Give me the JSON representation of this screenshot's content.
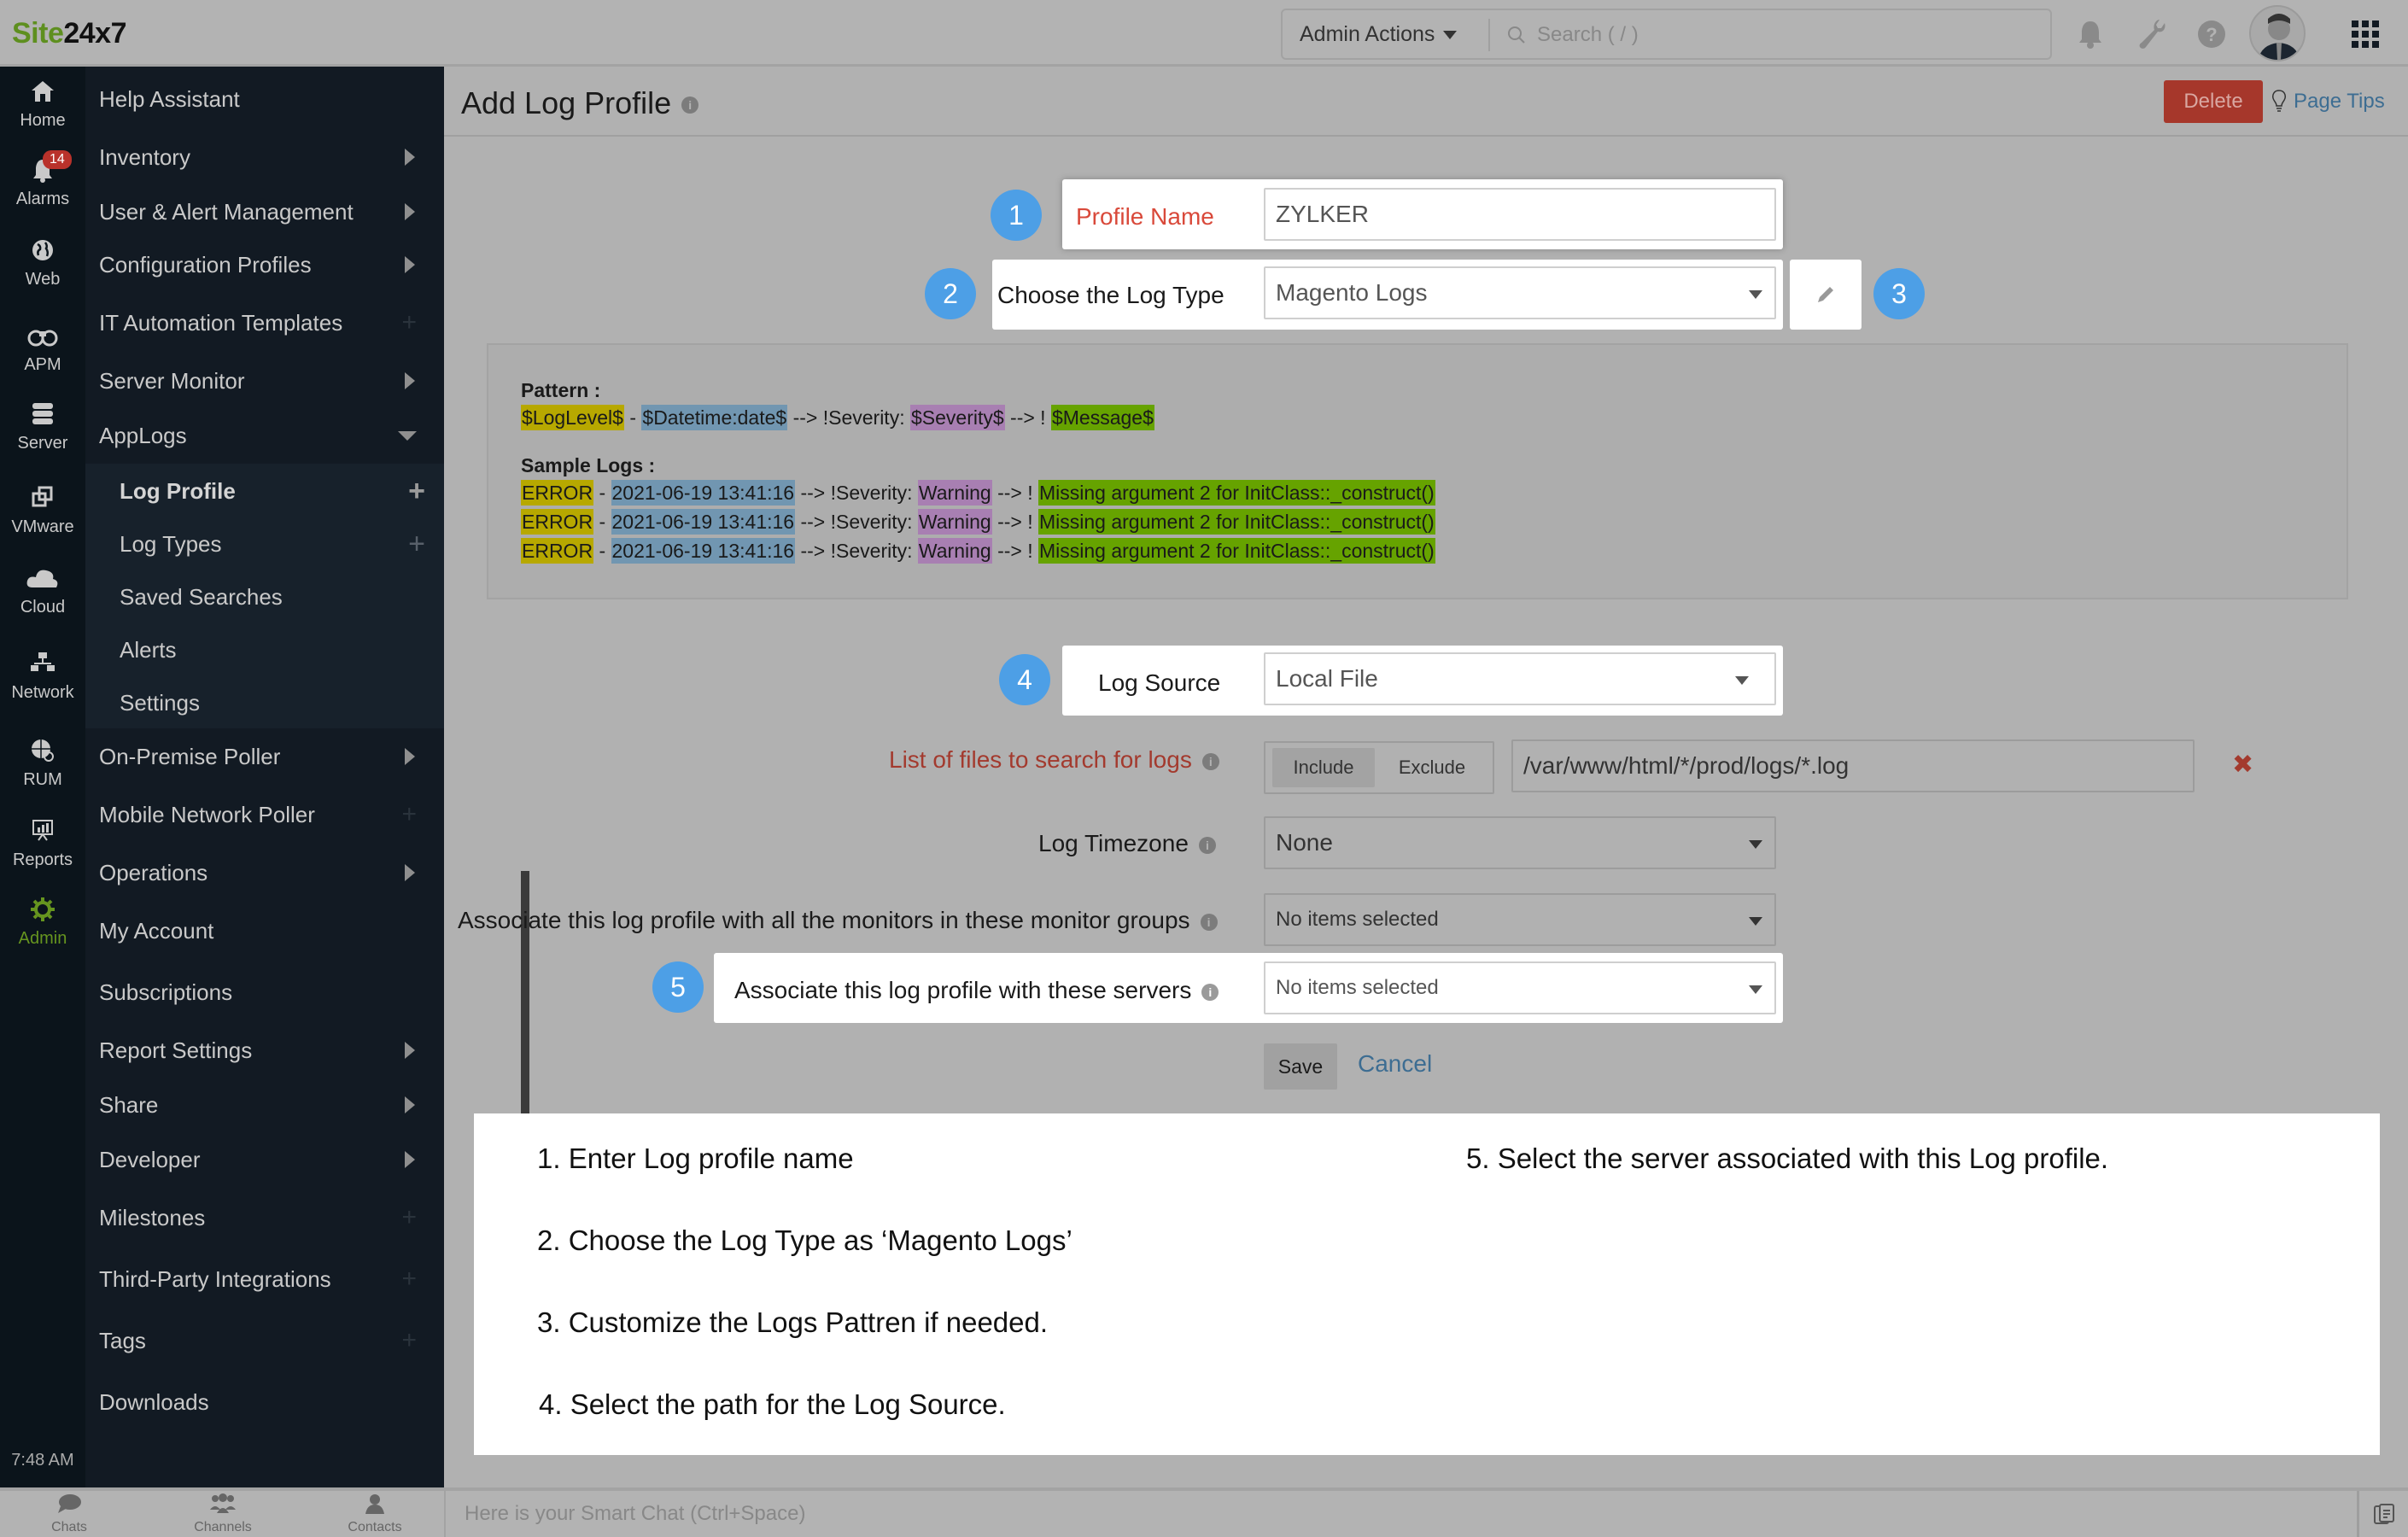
{
  "header": {
    "logo_part1": "Site",
    "logo_part2": "24x7",
    "admin_actions_label": "Admin Actions",
    "search_placeholder": "Search ( / )",
    "icons": [
      "bell-icon",
      "wrench-icon",
      "help-icon",
      "avatar",
      "app-grid-icon"
    ]
  },
  "rail": {
    "items": [
      {
        "label": "Home",
        "icon": "home-icon"
      },
      {
        "label": "Alarms",
        "icon": "bell-icon",
        "badge": "14"
      },
      {
        "label": "Web",
        "icon": "globe-icon"
      },
      {
        "label": "APM",
        "icon": "binoculars-icon"
      },
      {
        "label": "Server",
        "icon": "server-icon"
      },
      {
        "label": "VMware",
        "icon": "vmware-icon"
      },
      {
        "label": "Cloud",
        "icon": "cloud-icon"
      },
      {
        "label": "Network",
        "icon": "network-icon"
      },
      {
        "label": "RUM",
        "icon": "rum-icon"
      },
      {
        "label": "Reports",
        "icon": "reports-icon"
      },
      {
        "label": "Admin",
        "icon": "gear-icon",
        "active": true
      }
    ],
    "time": "7:48 AM"
  },
  "sidebar": {
    "items": [
      {
        "label": "Help Assistant"
      },
      {
        "label": "Inventory"
      },
      {
        "label": "User & Alert Management"
      },
      {
        "label": "Configuration Profiles"
      },
      {
        "label": "IT Automation Templates"
      },
      {
        "label": "Server Monitor"
      },
      {
        "label": "AppLogs"
      },
      {
        "label": "On-Premise Poller"
      },
      {
        "label": "Mobile Network Poller"
      },
      {
        "label": "Operations"
      },
      {
        "label": "My Account"
      },
      {
        "label": "Subscriptions"
      },
      {
        "label": "Report Settings"
      },
      {
        "label": "Share"
      },
      {
        "label": "Developer"
      },
      {
        "label": "Milestones"
      },
      {
        "label": "Third-Party Integrations"
      },
      {
        "label": "Tags"
      },
      {
        "label": "Downloads"
      }
    ],
    "applogs_sub": [
      {
        "label": "Log Profile",
        "active": true
      },
      {
        "label": "Log Types"
      },
      {
        "label": "Saved Searches"
      },
      {
        "label": "Alerts"
      },
      {
        "label": "Settings"
      }
    ]
  },
  "chatbar": {
    "tabs": [
      {
        "label": "Chats"
      },
      {
        "label": "Channels"
      },
      {
        "label": "Contacts"
      }
    ],
    "smart_chat_placeholder": "Here is your Smart Chat (Ctrl+Space)"
  },
  "page": {
    "title": "Add Log Profile",
    "delete_label": "Delete",
    "page_tips_label": "Page Tips"
  },
  "form": {
    "profile_name_label": "Profile Name",
    "profile_name_value": "ZYLKER",
    "log_type_label": "Choose the Log Type",
    "log_type_value": "Magento Logs",
    "log_source_label": "Log Source",
    "log_source_value": "Local File",
    "files_label": "List of files to search for logs",
    "include_label": "Include",
    "exclude_label": "Exclude",
    "file_path_value": "/var/www/html/*/prod/logs/*.log",
    "timezone_label": "Log Timezone",
    "timezone_value": "None",
    "monitor_groups_label": "Associate this log profile with all the monitors in these monitor groups",
    "monitor_groups_value": "No items selected",
    "servers_label": "Associate this log profile with these servers",
    "servers_value": "No items selected",
    "save_label": "Save",
    "cancel_label": "Cancel"
  },
  "pattern": {
    "pattern_heading": "Pattern :",
    "pattern_tokens": {
      "loglevel": "$LogLevel$",
      "sep1": " - ",
      "datetime": "$Datetime:date$",
      "sep2": " --> !Severity: ",
      "severity": "$Severity$",
      "sep3": " --> ! ",
      "message": "$Message$"
    },
    "sample_heading": "Sample Logs :",
    "samples": [
      {
        "level": "ERROR",
        "sep1": " - ",
        "datetime": "2021-06-19 13:41:16",
        "sep2": " --> !Severity: ",
        "severity": "Warning",
        "sep3": " --> ! ",
        "message": "Missing argument 2 for InitClass::_construct()"
      },
      {
        "level": "ERROR",
        "sep1": " - ",
        "datetime": "2021-06-19 13:41:16",
        "sep2": " --> !Severity: ",
        "severity": "Warning",
        "sep3": " --> ! ",
        "message": "Missing argument 2 for InitClass::_construct()"
      },
      {
        "level": "ERROR",
        "sep1": " - ",
        "datetime": "2021-06-19 13:41:16",
        "sep2": " --> !Severity: ",
        "severity": "Warning",
        "sep3": " --> ! ",
        "message": "Missing argument 2 for InitClass::_construct()"
      }
    ],
    "colors": {
      "loglevel": "#b7a800",
      "datetime": "#7196b1",
      "severity": "#a87fb2",
      "message": "#66a300"
    }
  },
  "steps": [
    "1",
    "2",
    "3",
    "4",
    "5"
  ],
  "instructions": [
    "1. Enter Log profile name",
    "2. Choose the Log Type as ‘Magento Logs’",
    "3. Customize the Logs Pattren if needed.",
    "4. Select the path for the Log Source.",
    "5. Select the server associated with this  Log profile."
  ],
  "colors": {
    "brand_green": "#5e8f1f",
    "step_blue": "#4d9fe6",
    "delete_red": "#a6372b",
    "link_blue": "#3d6d92",
    "required_red": "#d9493a"
  }
}
